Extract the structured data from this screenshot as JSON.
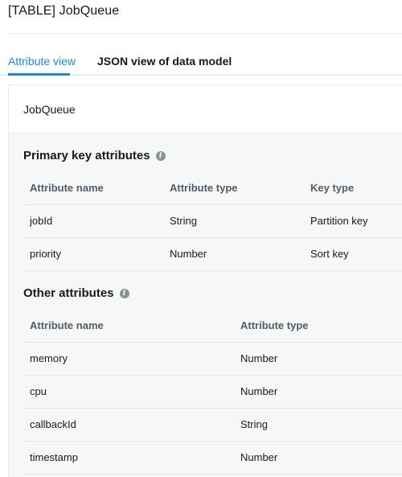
{
  "page_title": "[TABLE] JobQueue",
  "tabs": [
    {
      "label": "Attribute view",
      "active": true
    },
    {
      "label": "JSON view of data model",
      "active": false
    }
  ],
  "panel": {
    "title": "JobQueue",
    "primary_key": {
      "title": "Primary key attributes",
      "columns": [
        "Attribute name",
        "Attribute type",
        "Key type"
      ],
      "rows": [
        [
          "jobId",
          "String",
          "Partition key"
        ],
        [
          "priority",
          "Number",
          "Sort key"
        ]
      ]
    },
    "other": {
      "title": "Other attributes",
      "columns": [
        "Attribute name",
        "Attribute type"
      ],
      "rows": [
        [
          "memory",
          "Number"
        ],
        [
          "cpu",
          "Number"
        ],
        [
          "callbackId",
          "String"
        ],
        [
          "timestamp",
          "Number"
        ]
      ]
    }
  },
  "colors": {
    "accent": "#1a8be0",
    "panel_bg": "#f6f7f7",
    "info_icon": "#879596"
  }
}
